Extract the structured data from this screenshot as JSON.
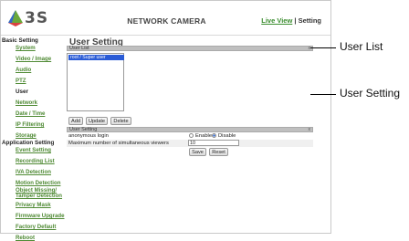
{
  "logo": {
    "text": "3S"
  },
  "header": {
    "title": "NETWORK CAMERA",
    "live_view": "Live View",
    "separator": "|",
    "setting": "Setting"
  },
  "sidebar": {
    "basic_heading": "Basic Setting",
    "items": [
      {
        "label": "System",
        "kind": "link"
      },
      {
        "label": "Video / Image",
        "kind": "link"
      },
      {
        "label": "Audio",
        "kind": "link"
      },
      {
        "label": "PTZ",
        "kind": "link"
      },
      {
        "label": "User",
        "kind": "plain"
      },
      {
        "label": "Network",
        "kind": "link"
      },
      {
        "label": "Date / Time",
        "kind": "link"
      },
      {
        "label": "IP Filtering",
        "kind": "link"
      },
      {
        "label": "Storage",
        "kind": "link"
      }
    ],
    "app_heading": "Application Setting",
    "app_items": [
      {
        "label": "Event Setting"
      },
      {
        "label": "Recording List"
      },
      {
        "label": "IVA Detection"
      },
      {
        "label": "Motion Detection"
      },
      {
        "label": "Object Missing/"
      },
      {
        "label": "Tamper Detection"
      },
      {
        "label": "Privacy Mask"
      },
      {
        "label": "Firmware Upgrade"
      },
      {
        "label": "Factory Default"
      },
      {
        "label": "Reboot"
      }
    ]
  },
  "main": {
    "title": "User Setting",
    "user_list": {
      "header": "User List",
      "close": "x",
      "items": [
        "root  /  Super user"
      ],
      "buttons": {
        "add": "Add",
        "update": "Update",
        "delete": "Delete"
      }
    },
    "user_setting": {
      "header": "User Setting",
      "close": "x",
      "anonymous_label": "anonymous login",
      "enable": "Enable",
      "disable": "Disable",
      "selected": "Disable",
      "max_viewers_label": "Maximum number of simultaneous viewers",
      "max_viewers_value": "10",
      "buttons": {
        "save": "Save",
        "reset": "Reset"
      }
    }
  },
  "annotations": {
    "user_list": "User List",
    "user_setting": "User Setting"
  },
  "colors": {
    "link_green": "#4f8a34",
    "selected_blue": "#2a5bd6",
    "bar_gray": "#bfbfbf"
  }
}
